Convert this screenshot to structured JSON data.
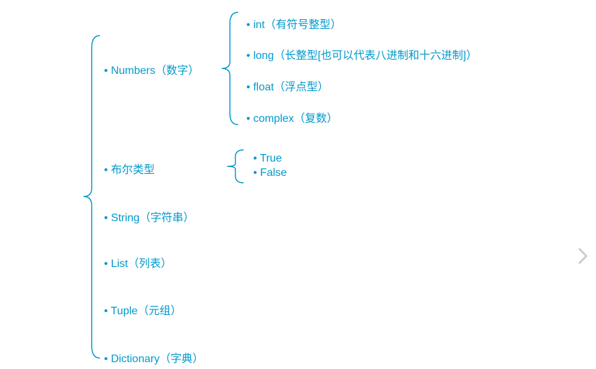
{
  "diagram": {
    "level1": [
      {
        "label": "Numbers（数字）"
      },
      {
        "label": "布尔类型"
      },
      {
        "label": "String（字符串）"
      },
      {
        "label": "List（列表）"
      },
      {
        "label": "Tuple（元组）"
      },
      {
        "label": "Dictionary（字典）"
      }
    ],
    "numbers_children": [
      {
        "label": "int（有符号整型）"
      },
      {
        "label": "long（长整型[也可以代表八进制和十六进制]）"
      },
      {
        "label": "float（浮点型）"
      },
      {
        "label": "complex（复数）"
      }
    ],
    "bool_children": [
      {
        "label": "True"
      },
      {
        "label": "False"
      }
    ]
  },
  "colors": {
    "text": "#0099cc",
    "brace": "#0099cc"
  }
}
